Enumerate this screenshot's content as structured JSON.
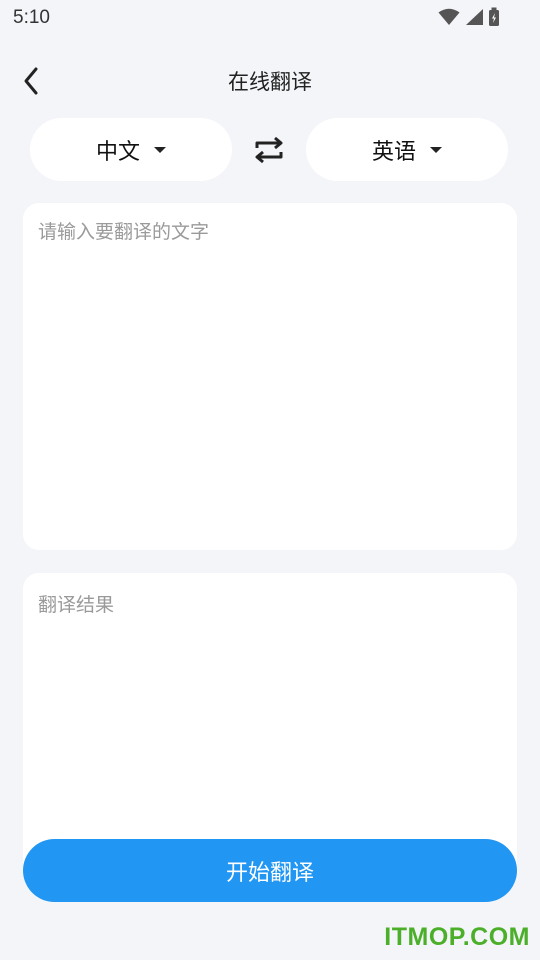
{
  "status_bar": {
    "time": "5:10",
    "icons": [
      "wifi-icon",
      "signal-icon",
      "battery-icon"
    ]
  },
  "app_bar": {
    "back_icon": "back-arrow-icon",
    "title": "在线翻译"
  },
  "languages": {
    "source": "中文",
    "target": "英语",
    "swap_icon": "swap-icon"
  },
  "input": {
    "placeholder": "请输入要翻译的文字",
    "value": ""
  },
  "result": {
    "placeholder": "翻译结果"
  },
  "actions": {
    "translate_label": "开始翻译"
  },
  "watermark": "ITMOP.COM",
  "colors": {
    "primary": "#2196f3",
    "background": "#f4f5f9",
    "watermark": "#4caf2a"
  }
}
